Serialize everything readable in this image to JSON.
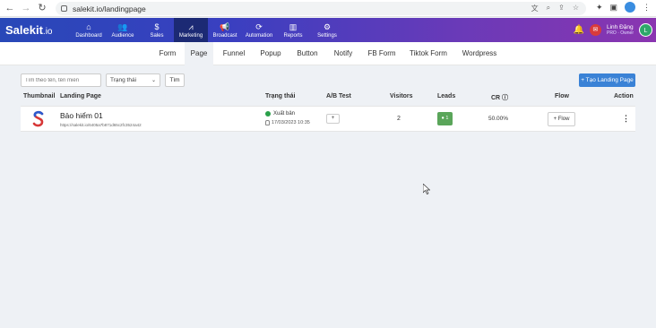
{
  "browser": {
    "url": "salekit.io/landingpage"
  },
  "app": {
    "logo": "Salekit",
    "logo_suffix": ".io",
    "nav": [
      {
        "label": "Dashboard",
        "icon": "home-icon",
        "glyph": "⌂"
      },
      {
        "label": "Audience",
        "icon": "users-icon",
        "glyph": "👥"
      },
      {
        "label": "Sales",
        "icon": "dollar-icon",
        "glyph": "$"
      },
      {
        "label": "Marketing",
        "icon": "chart-icon",
        "glyph": "⩘"
      },
      {
        "label": "Broadcast",
        "icon": "megaphone-icon",
        "glyph": "📢"
      },
      {
        "label": "Automation",
        "icon": "refresh-icon",
        "glyph": "⟳"
      },
      {
        "label": "Reports",
        "icon": "bar-chart-icon",
        "glyph": "▥"
      },
      {
        "label": "Settings",
        "icon": "gear-icon",
        "glyph": "⚙"
      }
    ],
    "user": {
      "name": "Linh Đặng",
      "role": "PRO · Owner",
      "initial": "L"
    }
  },
  "subtabs": [
    "Form",
    "Page",
    "Funnel",
    "Popup",
    "Button",
    "Notify",
    "FB Form",
    "Tiktok Form",
    "Wordpress"
  ],
  "active_subtab": "Page",
  "filters": {
    "search_placeholder": "Tìm theo tên, tên miền",
    "status_label": "Trạng thái",
    "find_label": "Tìm"
  },
  "create_button": "+ Tạo Landing Page",
  "table": {
    "headers": {
      "thumbnail": "Thumbnail",
      "landing_page": "Landing Page",
      "status": "Trạng thái",
      "ab_test": "A/B Test",
      "visitors": "Visitors",
      "leads": "Leads",
      "cr": "CR ⓘ",
      "flow": "Flow",
      "action": "Action"
    },
    "rows": [
      {
        "name": "Bảo hiểm 01",
        "url": "https://salekit.io/6405a7b871d65c2fc3524a42",
        "status": "Xuất bản",
        "date": "17/03/2023 10:35",
        "ab": "+",
        "visitors": "2",
        "leads": "1",
        "cr": "50.00%",
        "flow": "+ Flow",
        "action": "⋮"
      }
    ]
  },
  "colors": {
    "accent": "#3a82d6",
    "header_start": "#2848b8",
    "header_end": "#8a35b0",
    "published": "#2aa04a",
    "leads": "#5aa55a"
  }
}
